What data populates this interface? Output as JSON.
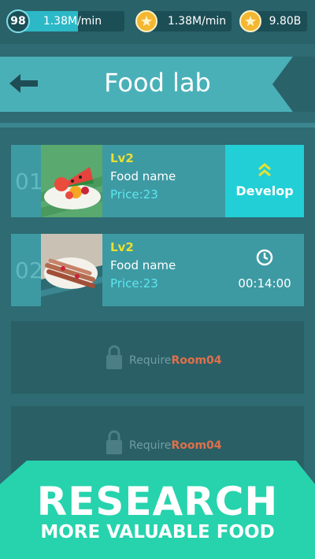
{
  "stats": {
    "level": "98",
    "level_progress": 0.55,
    "income_rate_1": "1.38M/min",
    "income_rate_2": "1.38M/min",
    "coins": "9.80B"
  },
  "header": {
    "title": "Food lab"
  },
  "recipes": [
    {
      "number": "01",
      "level": "Lv2",
      "name": "Food name",
      "price": "Price:23",
      "action_label": "Develop",
      "thumb": "watermelon-fruit-plate"
    },
    {
      "number": "02",
      "level": "Lv2",
      "name": "Food name",
      "price": "Price:23",
      "timer": "00:14:00",
      "thumb": "meat-skewers-plate"
    }
  ],
  "locked_slots": [
    {
      "require_label": "Require",
      "room": "Room04"
    },
    {
      "require_label": "Require",
      "room": "Room04"
    }
  ],
  "promo": {
    "headline": "RESEARCH",
    "subline": "MORE VALUABLE FOOD"
  },
  "colors": {
    "accent": "#22cfd6",
    "level_text": "#e8e032",
    "price_text": "#5fe6ee",
    "room_text": "#e0704a",
    "promo_bg": "#26d3ad"
  }
}
